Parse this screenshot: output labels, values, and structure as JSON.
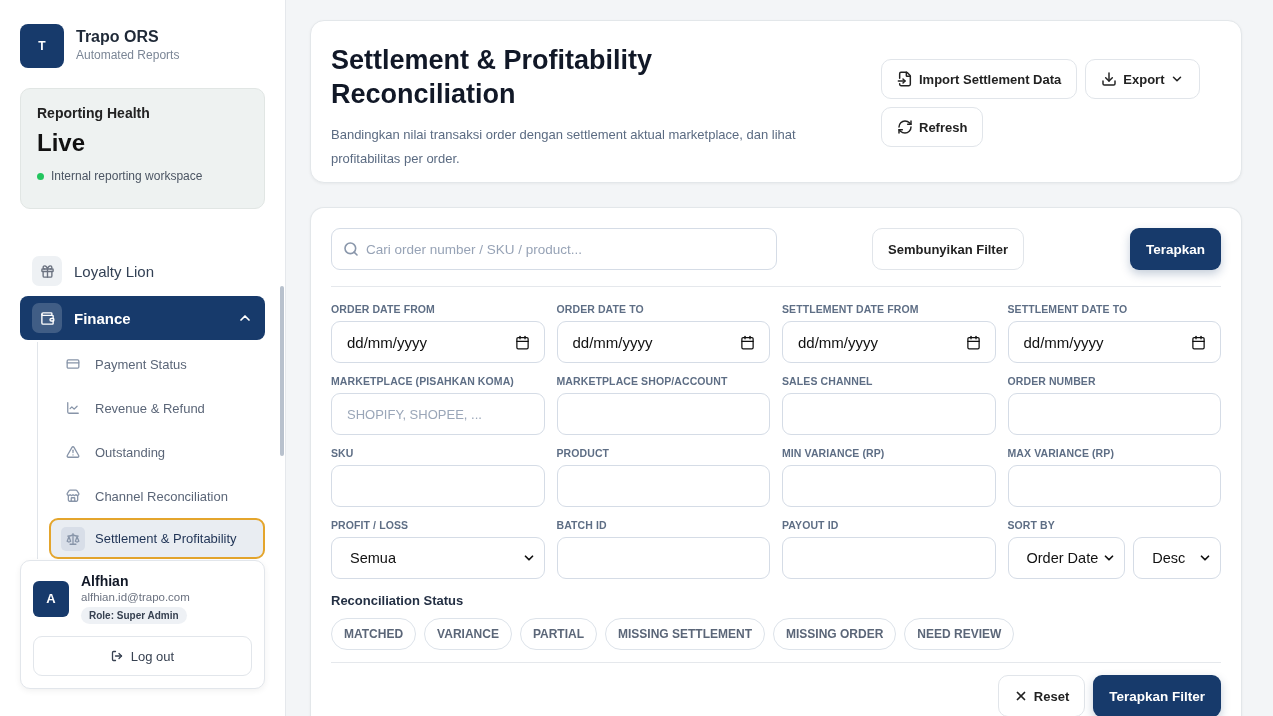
{
  "sidebar": {
    "brand": {
      "logo": "T",
      "name": "Trapo ORS",
      "subtitle": "Automated Reports"
    },
    "health": {
      "title": "Reporting Health",
      "status": "Live",
      "note": "Internal reporting workspace",
      "color": "#22c55e"
    },
    "nav": [
      {
        "label": "Loyalty Lion",
        "selected": false
      },
      {
        "label": "Finance",
        "selected": true,
        "expanded": true,
        "children": [
          {
            "label": "Payment Status",
            "selected": false
          },
          {
            "label": "Revenue & Refund",
            "selected": false
          },
          {
            "label": "Outstanding",
            "selected": false
          },
          {
            "label": "Channel Reconciliation",
            "selected": false
          },
          {
            "label": "Settlement & Profitability",
            "selected": true
          }
        ]
      }
    ],
    "user": {
      "avatar": "A",
      "name": "Alfhian",
      "email": "alfhian.id@trapo.com",
      "role": "Role: Super Admin"
    },
    "logout": "Log out"
  },
  "header": {
    "title": "Settlement & Profitability Reconciliation",
    "description": "Bandingkan nilai transaksi order dengan settlement aktual marketplace, dan lihat profitabilitas per order.",
    "actions": [
      {
        "label": "Import Settlement Data",
        "dropdown": false
      },
      {
        "label": "Export",
        "dropdown": true
      },
      {
        "label": "Refresh",
        "dropdown": false
      }
    ]
  },
  "filters": {
    "search_placeholder": "Cari order number / SKU / product...",
    "toggle": "Sembunyikan Filter",
    "apply": "Terapkan",
    "fields": [
      {
        "label": "ORDER DATE FROM",
        "kind": "date",
        "value": "dd/mm/yyyy"
      },
      {
        "label": "ORDER DATE TO",
        "kind": "date",
        "value": "dd/mm/yyyy"
      },
      {
        "label": "SETTLEMENT DATE FROM",
        "kind": "date",
        "value": "dd/mm/yyyy"
      },
      {
        "label": "SETTLEMENT DATE TO",
        "kind": "date",
        "value": "dd/mm/yyyy"
      },
      {
        "label": "MARKETPLACE (PISAHKAN KOMA)",
        "kind": "text",
        "placeholder": "SHOPIFY, SHOPEE, ..."
      },
      {
        "label": "MARKETPLACE SHOP/ACCOUNT",
        "kind": "text"
      },
      {
        "label": "SALES CHANNEL",
        "kind": "text"
      },
      {
        "label": "ORDER NUMBER",
        "kind": "text"
      },
      {
        "label": "SKU",
        "kind": "text"
      },
      {
        "label": "PRODUCT",
        "kind": "text"
      },
      {
        "label": "MIN VARIANCE (RP)",
        "kind": "text"
      },
      {
        "label": "MAX VARIANCE (RP)",
        "kind": "text"
      },
      {
        "label": "PROFIT / LOSS",
        "kind": "select",
        "values": [
          "Semua"
        ]
      },
      {
        "label": "BATCH ID",
        "kind": "text"
      },
      {
        "label": "PAYOUT ID",
        "kind": "text"
      },
      {
        "label": "SORT BY",
        "kind": "select",
        "values": [
          "Order Date",
          "Desc"
        ]
      }
    ],
    "status_title": "Reconciliation Status",
    "statuses": [
      {
        "label": "MATCHED",
        "selected": false
      },
      {
        "label": "VARIANCE",
        "selected": false
      },
      {
        "label": "PARTIAL",
        "selected": false
      },
      {
        "label": "MISSING SETTLEMENT",
        "selected": false
      },
      {
        "label": "MISSING ORDER",
        "selected": false
      },
      {
        "label": "NEED REVIEW",
        "selected": false
      }
    ],
    "reset": "Reset",
    "apply_filter": "Terapkan Filter"
  }
}
